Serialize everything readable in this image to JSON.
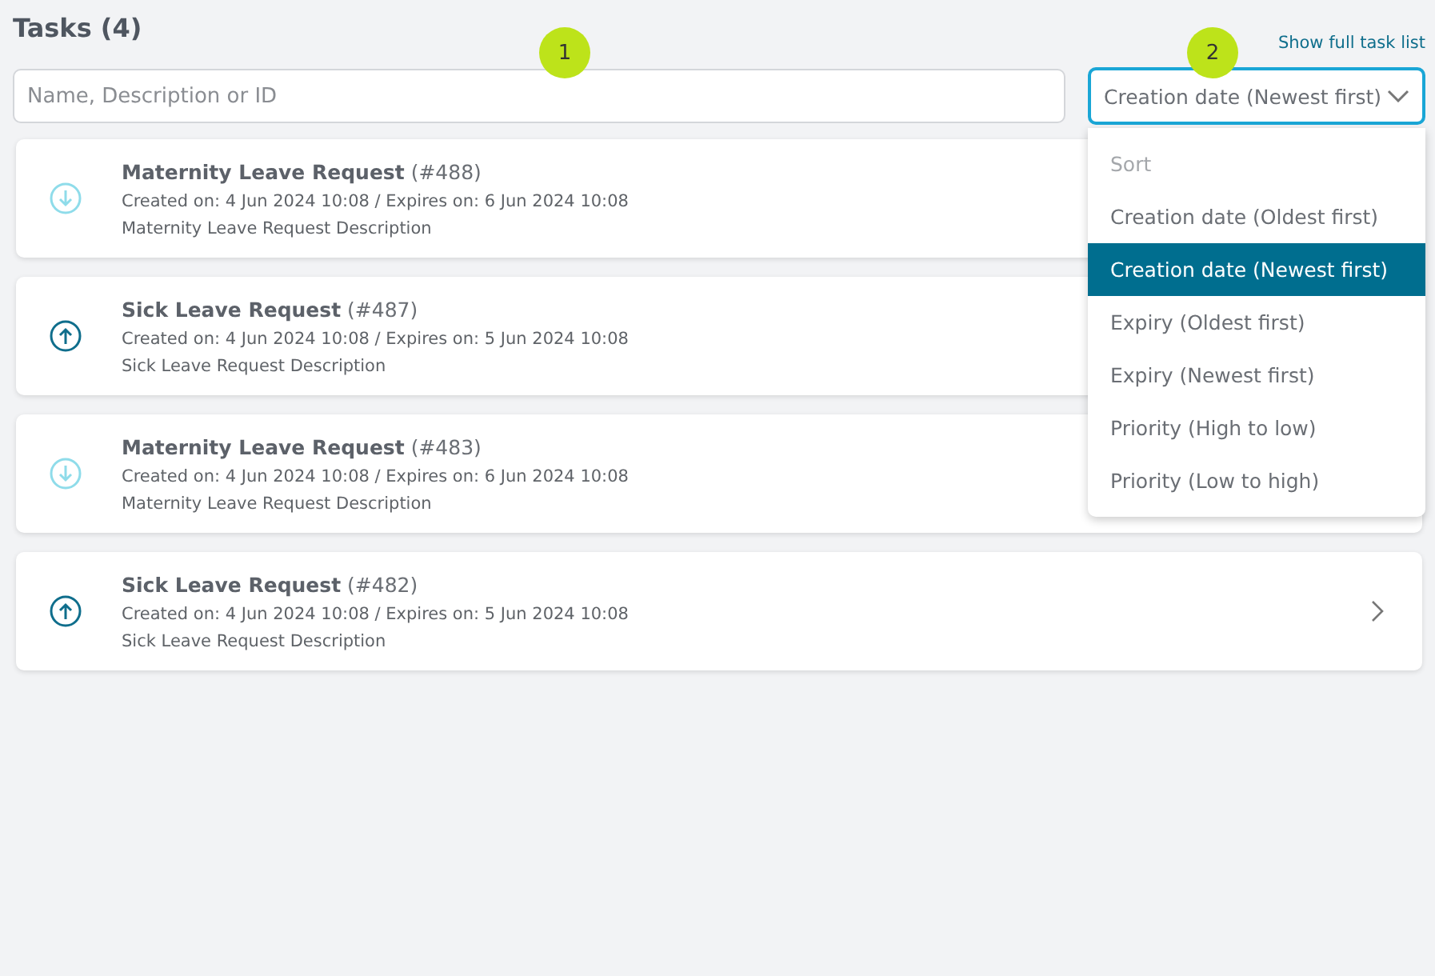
{
  "header": {
    "title": "Tasks (4)",
    "link": "Show full task list"
  },
  "search": {
    "placeholder": "Name, Description or ID",
    "callout": "1"
  },
  "sort": {
    "value": "Creation date (Newest first)",
    "callout": "2",
    "expanded": true,
    "heading": "Sort",
    "options": [
      {
        "label": "Creation date (Oldest first)",
        "selected": false
      },
      {
        "label": "Creation date (Newest first)",
        "selected": true
      },
      {
        "label": "Expiry (Oldest first)",
        "selected": false
      },
      {
        "label": "Expiry (Newest first)",
        "selected": false
      },
      {
        "label": "Priority (High to low)",
        "selected": false
      },
      {
        "label": "Priority (Low to high)",
        "selected": false
      }
    ]
  },
  "tasks": [
    {
      "name": "Maternity Leave Request",
      "id": "(#488)",
      "dates": "Created on: 4 Jun 2024 10:08 / Expires on: 6 Jun 2024 10:08",
      "description": "Maternity Leave Request Description",
      "kind": "low"
    },
    {
      "name": "Sick Leave Request",
      "id": "(#487)",
      "dates": "Created on: 4 Jun 2024 10:08 / Expires on: 5 Jun 2024 10:08",
      "description": "Sick Leave Request Description",
      "kind": "high"
    },
    {
      "name": "Maternity Leave Request",
      "id": "(#483)",
      "dates": "Created on: 4 Jun 2024 10:08 / Expires on: 6 Jun 2024 10:08",
      "description": "Maternity Leave Request Description",
      "kind": "low"
    },
    {
      "name": "Sick Leave Request",
      "id": "(#482)",
      "dates": "Created on: 4 Jun 2024 10:08 / Expires on: 5 Jun 2024 10:08",
      "description": "Sick Leave Request Description",
      "kind": "high"
    }
  ]
}
